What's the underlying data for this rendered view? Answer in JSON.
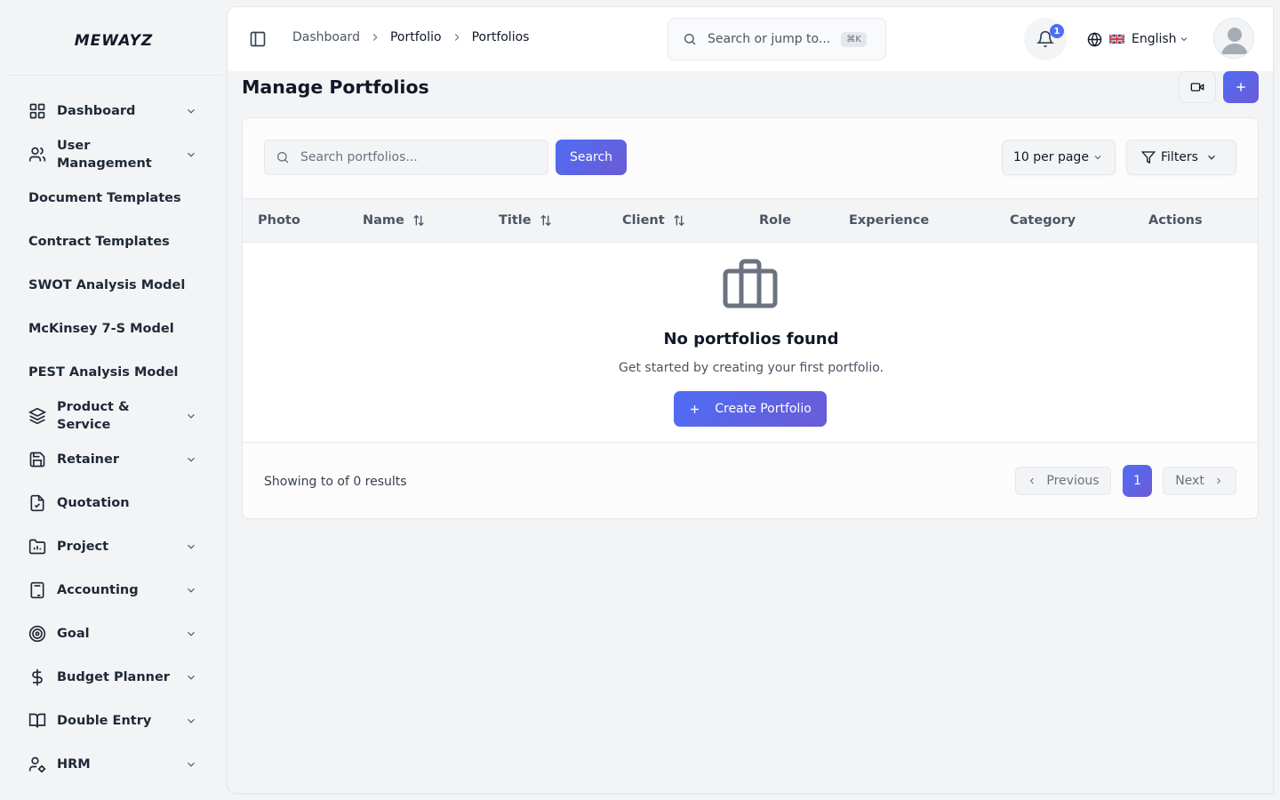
{
  "app": {
    "logo": "MEWAYZ"
  },
  "sidebar": {
    "items": [
      {
        "label": "Dashboard",
        "icon": "dashboard-grid-icon",
        "has_children": true
      },
      {
        "label": "User Management",
        "icon": "users-icon",
        "has_children": true
      },
      {
        "label": "Document Templates",
        "has_children": false
      },
      {
        "label": "Contract Templates",
        "has_children": false
      },
      {
        "label": "SWOT Analysis Model",
        "has_children": false
      },
      {
        "label": "McKinsey 7-S Model",
        "has_children": false
      },
      {
        "label": "PEST Analysis Model",
        "has_children": false
      },
      {
        "label": "Product & Service",
        "icon": "layers-icon",
        "has_children": true
      },
      {
        "label": "Retainer",
        "icon": "save-icon",
        "has_children": true
      },
      {
        "label": "Quotation",
        "icon": "file-check-icon",
        "has_children": false
      },
      {
        "label": "Project",
        "icon": "folder-chart-icon",
        "has_children": true
      },
      {
        "label": "Accounting",
        "icon": "calculator-icon",
        "has_children": true
      },
      {
        "label": "Goal",
        "icon": "target-icon",
        "has_children": true
      },
      {
        "label": "Budget Planner",
        "icon": "dollar-icon",
        "has_children": true
      },
      {
        "label": "Double Entry",
        "icon": "book-open-icon",
        "has_children": true
      },
      {
        "label": "HRM",
        "icon": "user-cog-icon",
        "has_children": true
      }
    ]
  },
  "header": {
    "breadcrumb": [
      "Dashboard",
      "Portfolio",
      "Portfolios"
    ],
    "search_placeholder": "Search or jump to...",
    "search_shortcut": "⌘K",
    "notification_count": "1",
    "language": "English"
  },
  "page": {
    "title": "Manage Portfolios"
  },
  "toolbar": {
    "search_placeholder": "Search portfolios...",
    "search_button": "Search",
    "per_page": "10 per page",
    "filters": "Filters"
  },
  "table": {
    "columns": [
      "Photo",
      "Name",
      "Title",
      "Client",
      "Role",
      "Experience",
      "Category",
      "Actions"
    ],
    "rows": []
  },
  "empty_state": {
    "title": "No portfolios found",
    "subtitle": "Get started by creating your first portfolio.",
    "button": "Create Portfolio"
  },
  "pagination": {
    "results_text": "Showing to of 0 results",
    "previous": "Previous",
    "current_page": "1",
    "next": "Next"
  },
  "colors": {
    "accent": "#4f6df5",
    "accent_end": "#6b5bd6",
    "background": "#f3f4f6"
  }
}
